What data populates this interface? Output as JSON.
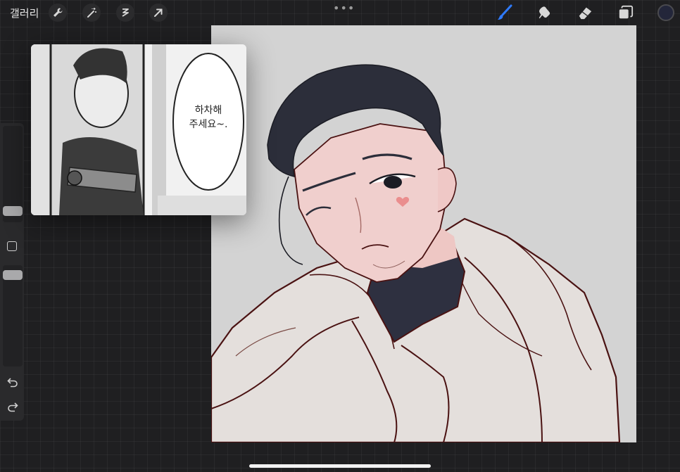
{
  "topbar": {
    "gallery_label": "갤러리",
    "more_label": "•••",
    "left_tools": [
      "wrench-icon",
      "magic-wand-icon",
      "selection-icon",
      "transform-arrow-icon"
    ],
    "right_tools": [
      "brush-icon",
      "smudge-icon",
      "eraser-icon",
      "layers-icon"
    ],
    "active_tool": "brush-icon",
    "accent_color": "#2f7bff",
    "current_color": "#23263a"
  },
  "sidebar": {
    "brush_size_level": 0.21,
    "opacity_level": 0.12,
    "icons": [
      "modify-square-icon",
      "undo-icon",
      "redo-icon"
    ]
  },
  "reference": {
    "speech_bubble_text": "하차해\n주세요~."
  },
  "canvas": {
    "background_color": "#d3d3d3",
    "line_color": "#4a1212",
    "skin_color": "#f0cfcd",
    "hair_color": "#2c2e3a",
    "cloak_color": "#e4dfdc"
  }
}
